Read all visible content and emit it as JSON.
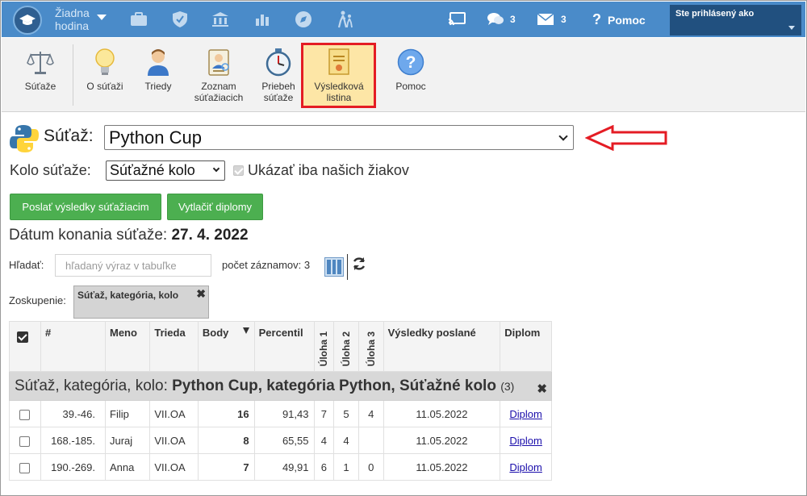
{
  "topbar": {
    "hour_line1": "Žiadna",
    "hour_line2": "hodina",
    "messages_count": "3",
    "mail_count": "3",
    "help_label": "Pomoc",
    "user_label": "Ste prihlásený ako"
  },
  "ribbon": {
    "items": [
      {
        "label": "Súťaže",
        "icon": "scales-icon"
      },
      {
        "label": "O súťaži",
        "icon": "lightbulb-icon"
      },
      {
        "label": "Triedy",
        "icon": "person-icon"
      },
      {
        "label": "Zoznam súťažiacich",
        "icon": "id-badge-icon"
      },
      {
        "label": "Priebeh súťaže",
        "icon": "stopwatch-icon"
      },
      {
        "label": "Výsledková listina",
        "icon": "certificate-icon"
      },
      {
        "label": "Pomoc",
        "icon": "help-icon"
      }
    ]
  },
  "competition": {
    "label": "Súťaž:",
    "selected": "Python Cup",
    "round_label": "Kolo súťaže:",
    "round_selected": "Súťažné kolo",
    "only_ours_label": "Ukázať iba našich žiakov"
  },
  "buttons": {
    "send_results": "Poslať výsledky súťažiacim",
    "print_diplomas": "Vytlačiť diplomy"
  },
  "date": {
    "label": "Dátum konania súťaže:",
    "value": "27. 4. 2022"
  },
  "search": {
    "label": "Hľadať:",
    "placeholder": "hľadaný výraz v tabuľke",
    "record_count": "počet záznamov: 3"
  },
  "grouping": {
    "label": "Zoskupenie:",
    "chip": "Súťaž, kategória, kolo",
    "close": "✖"
  },
  "table": {
    "headers": {
      "num": "#",
      "name": "Meno",
      "class": "Trieda",
      "points": "Body",
      "percentile": "Percentil",
      "task1": "Úloha 1",
      "task2": "Úloha 2",
      "task3": "Úloha 3",
      "sent": "Výsledky poslané",
      "diploma": "Diplom"
    },
    "group": {
      "prefix": "Súťaž, kategória, kolo: ",
      "value": "Python Cup, kategória Python, Súťažné kolo",
      "count": "(3)"
    },
    "rows": [
      {
        "rank": "39.-46.",
        "name": "Filip",
        "class": "VII.OA",
        "points": "16",
        "percentile": "91,43",
        "t1": "7",
        "t2": "5",
        "t3": "4",
        "sent": "11.05.2022",
        "diploma": "Diplom"
      },
      {
        "rank": "168.-185.",
        "name": "Juraj",
        "class": "VII.OA",
        "points": "8",
        "percentile": "65,55",
        "t1": "4",
        "t2": "4",
        "t3": "",
        "sent": "11.05.2022",
        "diploma": "Diplom"
      },
      {
        "rank": "190.-269.",
        "name": "Anna",
        "class": "VII.OA",
        "points": "7",
        "percentile": "49,91",
        "t1": "6",
        "t2": "1",
        "t3": "0",
        "sent": "11.05.2022",
        "diploma": "Diplom"
      }
    ]
  },
  "colors": {
    "topbar": "#4a8bc9",
    "user_box": "#21507f",
    "green_button": "#4caf50",
    "highlight_border": "#e41c24",
    "highlight_fill": "#fde6a6"
  }
}
